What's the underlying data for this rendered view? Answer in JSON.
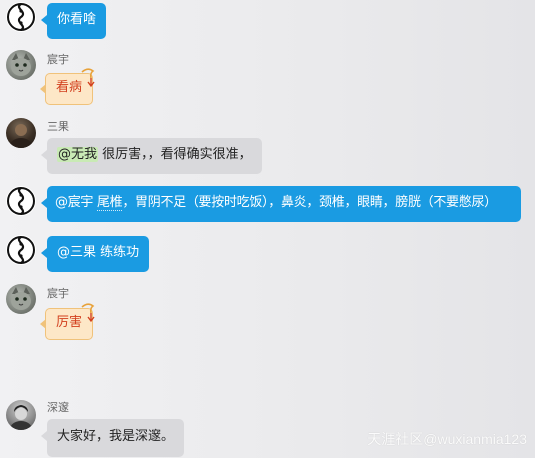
{
  "messages": [
    {
      "sender": "",
      "text": "你看啥"
    },
    {
      "sender": "宸宇",
      "text": "看病"
    },
    {
      "sender": "三果",
      "mention": "@无我",
      "text": " 很厉害，，看得确实很准，"
    },
    {
      "sender": "",
      "mention": "@宸宇",
      "underlined": "尾椎",
      "text": "，胃阴不足（要按时吃饭），鼻炎，颈椎，眼睛，膀胱（不要憋尿）"
    },
    {
      "sender": "",
      "text": "@三果 练练功"
    },
    {
      "sender": "宸宇",
      "text": "厉害"
    },
    {
      "sender": "深邃",
      "text": "大家好，我是深邃。"
    }
  ],
  "watermark": "天涯社区@wuxianmia123",
  "colors": {
    "self_bubble": "#1a9be2",
    "other_bubble": "#d9d9dc",
    "note_bubble": "#fde7c7",
    "note_text": "#d2401f",
    "mention_highlight": "#c9eab5"
  },
  "icons": {
    "self_avatar": "taiji-icon",
    "note_curl": "curl-icon"
  }
}
